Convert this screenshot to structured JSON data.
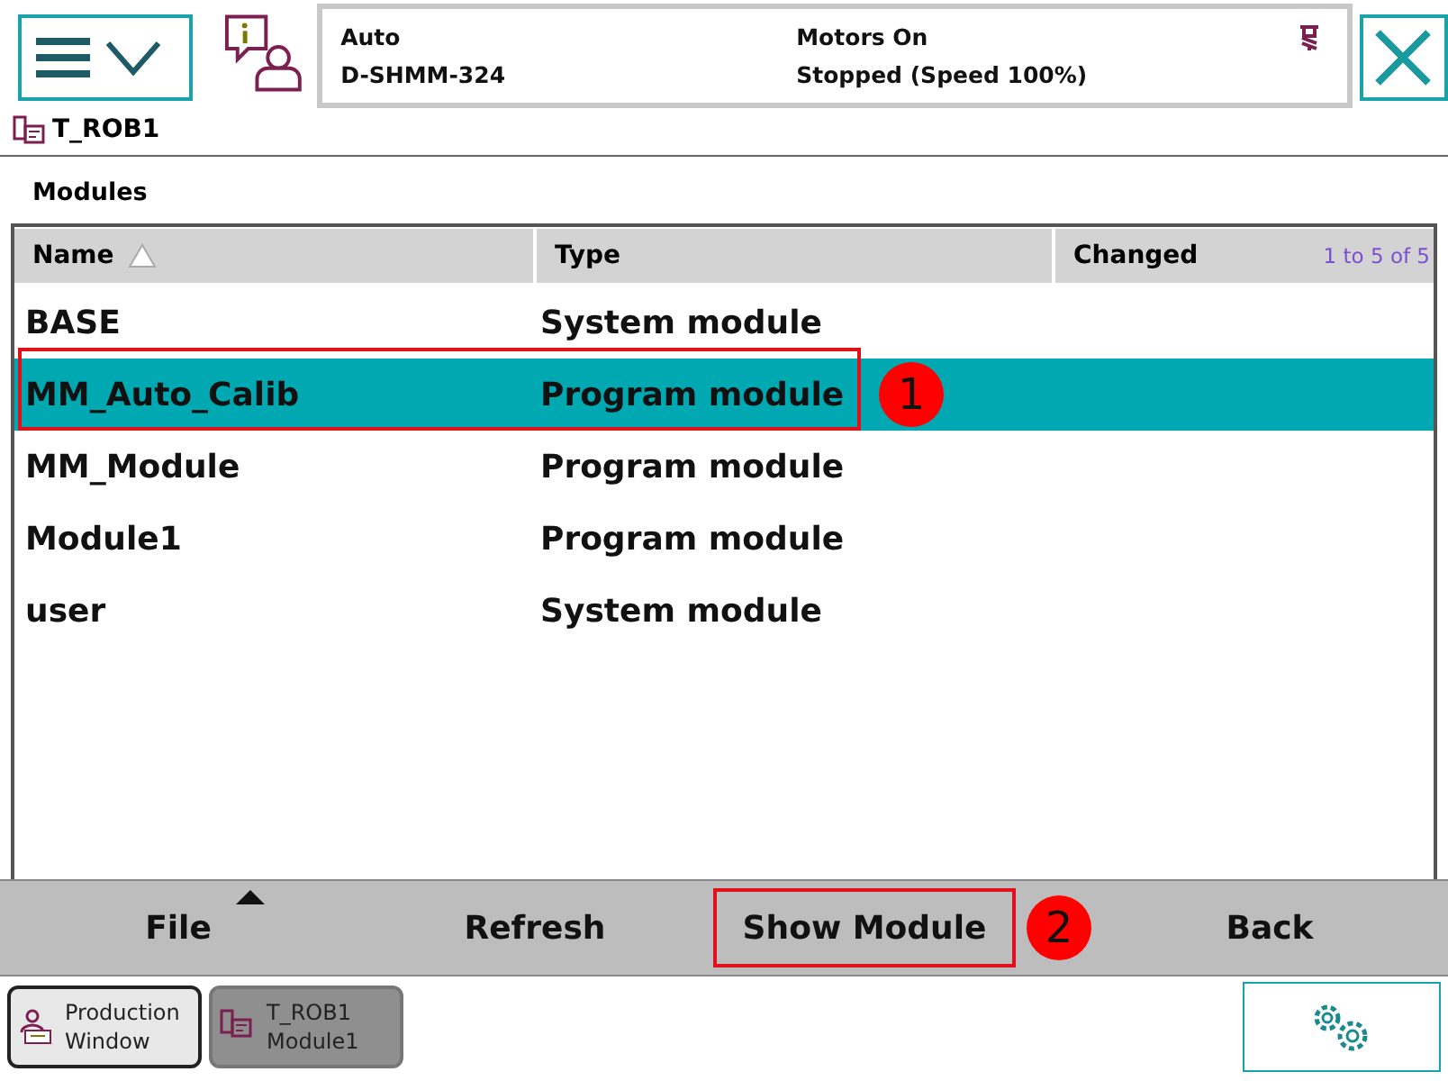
{
  "status": {
    "mode": "Auto",
    "controller": "D-SHMM-324",
    "motors": "Motors On",
    "state": "Stopped (Speed 100%)"
  },
  "task": "T_ROB1",
  "section_title": "Modules",
  "table": {
    "columns": [
      {
        "label": "Name",
        "sorted": true
      },
      {
        "label": "Type",
        "sorted": false
      },
      {
        "label": "Changed",
        "sorted": false
      }
    ],
    "count": "1 to 5 of 5",
    "rows": [
      {
        "name": "BASE",
        "type": "System module",
        "selected": false
      },
      {
        "name": "MM_Auto_Calib",
        "type": "Program module",
        "selected": true,
        "annotation": "1"
      },
      {
        "name": "MM_Module",
        "type": "Program module",
        "selected": false
      },
      {
        "name": "Module1",
        "type": "Program module",
        "selected": false
      },
      {
        "name": "user",
        "type": "System module",
        "selected": false
      }
    ]
  },
  "toolbar": [
    {
      "label": "File",
      "kind": "menu"
    },
    {
      "label": "Refresh",
      "kind": "button"
    },
    {
      "label": "Show Module",
      "kind": "button",
      "annotation": "2"
    },
    {
      "label": "Back",
      "kind": "button"
    }
  ],
  "taskbar": [
    {
      "line1": "Production",
      "line2": "Window",
      "selected": true
    },
    {
      "line1": "T_ROB1",
      "line2": "Module1",
      "selected": false
    }
  ]
}
